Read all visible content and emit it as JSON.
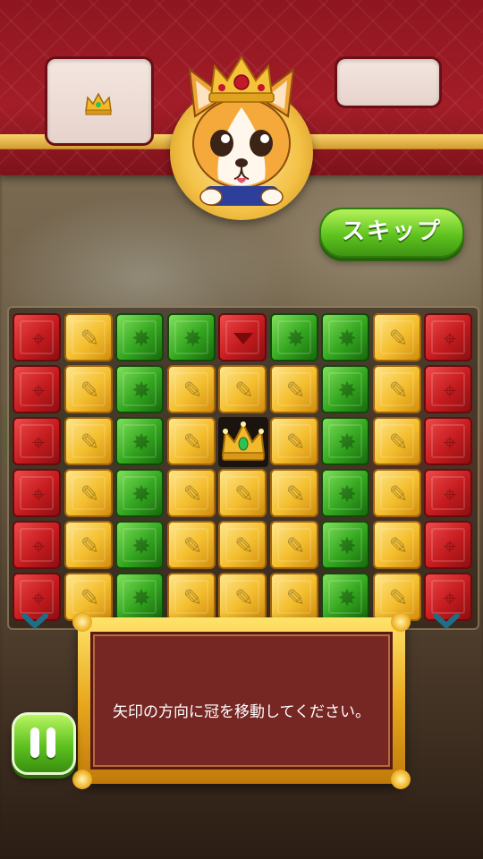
{
  "skip_button": {
    "label": "スキップ"
  },
  "dialog": {
    "message": "矢印の方向に冠を移動してください。"
  },
  "goal_slot": {
    "icon": "crown-icon"
  },
  "board": {
    "rows": [
      [
        "red",
        "yellow",
        "green",
        "green",
        "red-arrow",
        "green",
        "green",
        "yellow",
        "red"
      ],
      [
        "red",
        "yellow",
        "green",
        "yellow",
        "yellow",
        "yellow",
        "green",
        "yellow",
        "red"
      ],
      [
        "red",
        "yellow",
        "green",
        "yellow",
        "crown",
        "yellow",
        "green",
        "yellow",
        "red"
      ],
      [
        "red",
        "yellow",
        "green",
        "yellow",
        "yellow",
        "yellow",
        "green",
        "yellow",
        "red"
      ],
      [
        "red",
        "yellow",
        "green",
        "yellow",
        "yellow",
        "yellow",
        "green",
        "yellow",
        "red"
      ],
      [
        "red",
        "yellow",
        "green",
        "yellow",
        "yellow",
        "yellow",
        "green",
        "yellow",
        "red"
      ]
    ]
  },
  "colors": {
    "accent_green": "#5fc41f",
    "header_red": "#a31d27",
    "gold": "#f0b42a",
    "dialog_bg": "#762724"
  }
}
